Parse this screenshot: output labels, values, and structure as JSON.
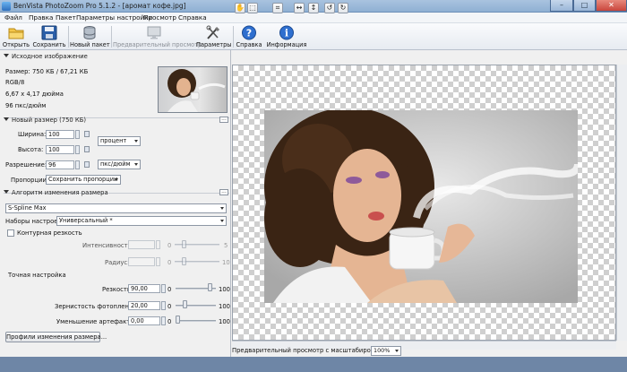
{
  "window": {
    "title": "BenVista PhotoZoom Pro 5.1.2 - [аромат кофе.jpg]",
    "controls": [
      "–",
      "□",
      "✕"
    ]
  },
  "menu": [
    "Файл",
    "Правка",
    "Пакет",
    "Параметры настройки",
    "Просмотр",
    "Справка"
  ],
  "toolbar": {
    "open": "Открыть",
    "save": "Сохранить",
    "new_batch": "Новый пакет",
    "preview": "Предварительный просмотр",
    "params": "Параметры",
    "help": "Справка",
    "info": "Информация"
  },
  "source": {
    "header": "Исходное изображение",
    "size": "Размер: 750 КБ / 67,21 КБ",
    "mode": "RGB/8",
    "dims": "6,67 x 4,17 дюйма",
    "dpi": "96 пкс/дюйм"
  },
  "new_size": {
    "header": "Новый размер (750 КБ)",
    "dots": "...",
    "width_label": "Ширина:",
    "width_value": "100",
    "height_label": "Высота:",
    "height_value": "100",
    "unit_select": "процент",
    "resolution_label": "Разрешение:",
    "resolution_value": "96",
    "resolution_unit": "пкс/дюйм",
    "proportions_label": "Пропорции:",
    "proportions_select": "Сохранить пропорции"
  },
  "algorithm": {
    "header": "Алгоритм изменения размера",
    "dots": "...",
    "method": "S-Spline Max",
    "presets_label": "Наборы настроек:",
    "presets_value": "Универсальный *",
    "sharpness_check": "Контурная резкость",
    "intensity_label": "Интенсивность:",
    "intensity_min": "0",
    "intensity_max": "5",
    "radius_label": "Радиус:",
    "radius_min": "0",
    "radius_max": "10",
    "fine_header": "Точная настройка",
    "sharp_label": "Резкость:",
    "sharp_value": "90,00",
    "sharp_min": "0",
    "sharp_max": "100",
    "sharp_level": 0.9,
    "grain_label": "Зернистость фотопленки:",
    "grain_value": "20,00",
    "grain_min": "0",
    "grain_max": "100",
    "grain_level": 0.2,
    "artifact_label": "Уменьшение артефактов:",
    "artifact_value": "0,00",
    "artifact_min": "0",
    "artifact_max": "100",
    "artifact_level": 0.0,
    "profiles_button": "Профили изменения размера..."
  },
  "viewer": {
    "zoom_label": "Предварительный просмотр с масштабированием:",
    "zoom_value": "100%"
  },
  "icons": {
    "open": "folder-icon",
    "save": "floppy-icon",
    "batch": "database-icon",
    "preview": "monitor-icon",
    "params": "tools-icon",
    "help": "help-icon",
    "info": "info-icon"
  },
  "colors": {
    "title_bar": "#9fbadb",
    "help_blue": "#2f6fcf",
    "close_red": "#c9463d"
  }
}
